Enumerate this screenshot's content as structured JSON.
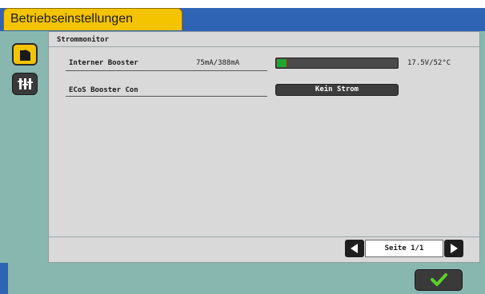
{
  "header": {
    "tab_title": "Betriebseinstellungen"
  },
  "sidebar": {
    "items": [
      {
        "name": "power-monitor",
        "active": true
      },
      {
        "name": "settings-sliders",
        "active": false
      }
    ]
  },
  "section": {
    "title": "Strommonitor"
  },
  "boosters": [
    {
      "label": "Interner Booster",
      "current": "75mA/388mA",
      "load_fraction": 0.08,
      "status": "17.5V/52°C"
    },
    {
      "label": "ECoS Booster Con",
      "status_button": "Kein Strom"
    }
  ],
  "pager": {
    "text": "Seite 1/1"
  },
  "colors": {
    "accent": "#f4c400",
    "header": "#2f63b3",
    "frame": "#88b7b0",
    "content": "#d9d9d9",
    "ok": "#5ad12b",
    "bar_fill": "#1ea82f",
    "bar_marker": "#c81616"
  },
  "icons": {
    "prev": "triangle-left-icon",
    "next": "triangle-right-icon",
    "ok": "checkmark-icon"
  }
}
